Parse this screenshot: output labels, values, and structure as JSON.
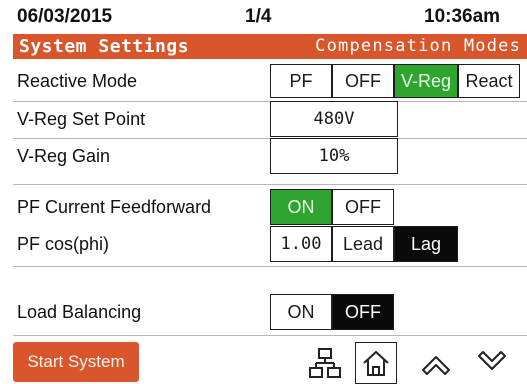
{
  "status": {
    "date": "06/03/2015",
    "page": "1/4",
    "time": "10:36am"
  },
  "title": {
    "left": "System Settings",
    "right": "Compensation Modes"
  },
  "rows": {
    "reactive_mode": {
      "label": "Reactive Mode",
      "options": [
        "PF",
        "OFF",
        "V-Reg",
        "React"
      ],
      "selected": "V-Reg"
    },
    "vreg_set_point": {
      "label": "V-Reg Set Point",
      "value": "480V"
    },
    "vreg_gain": {
      "label": "V-Reg Gain",
      "value": "10%"
    },
    "pf_feedforward": {
      "label": "PF Current Feedforward",
      "options": [
        "ON",
        "OFF"
      ],
      "selected": "ON"
    },
    "pf_cos_phi": {
      "label": "PF cos(phi)",
      "value": "1.00",
      "options": [
        "Lead",
        "Lag"
      ],
      "selected": "Lag"
    },
    "load_balancing": {
      "label": "Load Balancing",
      "options": [
        "ON",
        "OFF"
      ],
      "selected": "OFF"
    }
  },
  "bottom": {
    "start_label": "Start System"
  },
  "icons": [
    "network-icon",
    "home-icon",
    "chevron-up-icon",
    "chevron-down-icon"
  ],
  "colors": {
    "accent": "#d9562d",
    "selected_green": "#2fa52f",
    "selected_black": "#0a0a0a"
  }
}
